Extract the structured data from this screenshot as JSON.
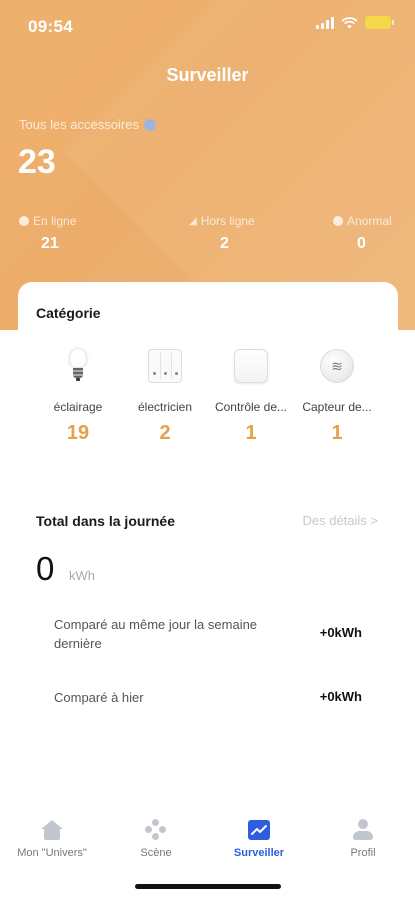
{
  "status_bar": {
    "time": "09:54"
  },
  "header": {
    "title": "Surveiller"
  },
  "summary": {
    "all_accessories_label": "Tous les accessoires",
    "all_accessories_count": "23",
    "stats": [
      {
        "label": "En ligne",
        "value": "21"
      },
      {
        "label": "Hors ligne",
        "value": "2"
      },
      {
        "label": "Anormal",
        "value": "0"
      }
    ]
  },
  "category": {
    "title": "Catégorie",
    "items": [
      {
        "name": "éclairage",
        "count": "19",
        "icon": "light-bulb-icon"
      },
      {
        "name": "électricien",
        "count": "2",
        "icon": "wall-switch-icon"
      },
      {
        "name": "Contrôle de...",
        "count": "1",
        "icon": "control-panel-icon"
      },
      {
        "name": "Capteur de...",
        "count": "1",
        "icon": "sensor-icon"
      }
    ]
  },
  "energy": {
    "title": "Total dans la journée",
    "details_link": "Des détails >",
    "value": "0",
    "unit": "kWh",
    "comparisons": [
      {
        "label": "Comparé au même jour la semaine dernière",
        "value": "+0kWh"
      },
      {
        "label": "Comparé à hier",
        "value": "+0kWh"
      }
    ]
  },
  "tabbar": {
    "tabs": [
      {
        "label": "Mon \"Univers\"",
        "icon": "home-icon"
      },
      {
        "label": "Scène",
        "icon": "scene-icon"
      },
      {
        "label": "Surveiller",
        "icon": "monitor-chart-icon",
        "active": true
      },
      {
        "label": "Profil",
        "icon": "profile-icon"
      }
    ]
  },
  "colors": {
    "header_bg": "#eeb16d",
    "accent_orange": "#e6a04c",
    "active_tab_blue": "#2f5de0"
  }
}
